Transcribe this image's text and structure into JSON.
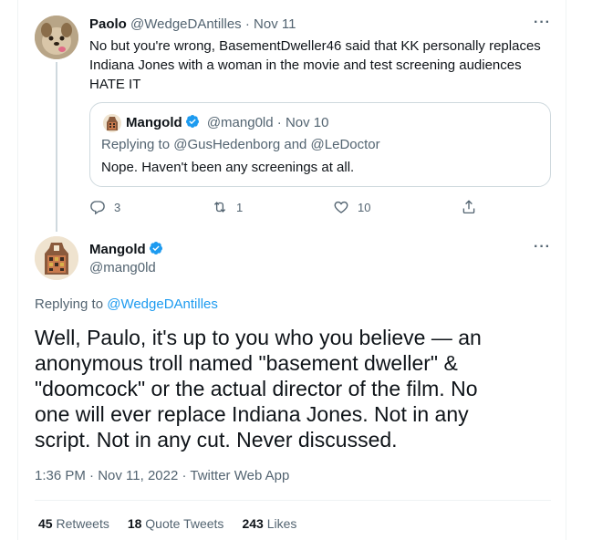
{
  "reply_tweet": {
    "display_name": "Paolo",
    "handle": "@WedgeDAntilles",
    "separator": "·",
    "date": "Nov 11",
    "text": "No but you're wrong, BasementDweller46 said that KK personally replaces Indiana Jones with a woman in the movie and test screening audiences HATE IT",
    "more_icon": "more-icon",
    "quoted_tweet": {
      "display_name": "Mangold",
      "handle": "@mang0ld",
      "separator": "·",
      "date": "Nov 10",
      "replying_prefix": "Replying to",
      "replying_to": "@GusHedenborg and @LeDoctor",
      "text": "Nope. Haven't been any screenings at all."
    },
    "actions": {
      "replies": "3",
      "retweets": "1",
      "likes": "10"
    }
  },
  "main_tweet": {
    "display_name": "Mangold",
    "handle": "@mang0ld",
    "replying_prefix": "Replying to",
    "replying_to": "@WedgeDAntilles",
    "text": "Well, Paulo, it's up to you who you believe — an anonymous troll named \"basement dweller\" & \"doomcock\" or the actual director of the film. No one will ever replace Indiana Jones. Not in any script. Not in any cut. Never discussed.",
    "timestamp": "1:36 PM · Nov 11, 2022 · Twitter Web App",
    "stats": {
      "retweets_count": "45",
      "retweets_label": "Retweets",
      "quotes_count": "18",
      "quotes_label": "Quote Tweets",
      "likes_count": "243",
      "likes_label": "Likes"
    }
  },
  "colors": {
    "accent": "#1d9bf0",
    "muted": "#536471",
    "text": "#0f1419",
    "border": "#cfd9de"
  }
}
